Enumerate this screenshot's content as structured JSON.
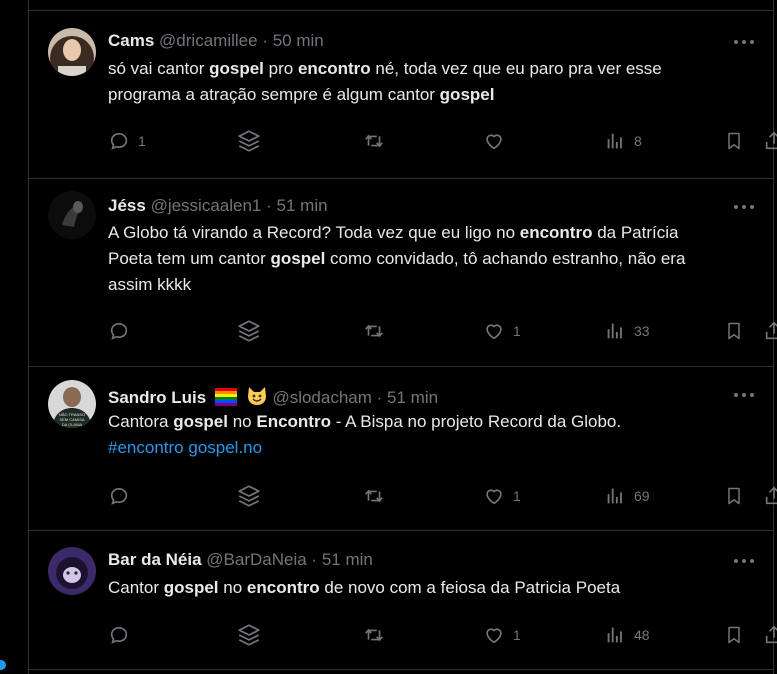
{
  "tweets": [
    {
      "name": "Cams",
      "handle": "@dricamillee",
      "sep": "·",
      "time": "50 min",
      "lines": [
        [
          {
            "t": "só vai cantor "
          },
          {
            "b": "gospel"
          },
          {
            "t": " pro "
          },
          {
            "b": "encontro"
          },
          {
            "t": " né, toda vez que eu paro pra ver esse"
          }
        ],
        [
          {
            "t": "programa a atração sempre é algum cantor "
          },
          {
            "b": "gospel"
          }
        ]
      ],
      "replies": "1",
      "likes": "",
      "views": "8"
    },
    {
      "name": "Jéss",
      "handle": "@jessicaalen1",
      "sep": "·",
      "time": "51 min",
      "lines": [
        [
          {
            "t": "A Globo tá virando a Record? Toda vez que eu ligo no "
          },
          {
            "b": "encontro"
          },
          {
            "t": " da Patrícia"
          }
        ],
        [
          {
            "t": "Poeta tem um cantor "
          },
          {
            "b": "gospel"
          },
          {
            "t": " como convidado, tô achando estranho, não era"
          }
        ],
        [
          {
            "t": "assim kkkk"
          }
        ]
      ],
      "replies": "",
      "likes": "1",
      "views": "33"
    },
    {
      "name": "Sandro Luis",
      "handle": "@slodacham",
      "sep": "·",
      "time": "51 min",
      "emojis": [
        "rainbow-flag",
        "smiling-cat"
      ],
      "avatar_text": [
        "NÃO TRANSO",
        "SEM CAMISA",
        "DA GLAMA"
      ],
      "lines": [
        [
          {
            "t": "Cantora "
          },
          {
            "b": "gospel"
          },
          {
            "t": " no "
          },
          {
            "b": "Encontro"
          },
          {
            "t": " - A Bispa no projeto Record da Globo."
          }
        ],
        [
          {
            "tag": "#encontro"
          },
          {
            "t": " "
          },
          {
            "link": "gospel.no"
          }
        ]
      ],
      "replies": "",
      "likes": "1",
      "views": "69"
    },
    {
      "name": "Bar da Néia",
      "handle": "@BarDaNeia",
      "sep": "·",
      "time": "51 min",
      "lines": [
        [
          {
            "t": "Cantor "
          },
          {
            "b": "gospel"
          },
          {
            "t": " no "
          },
          {
            "b": "encontro"
          },
          {
            "t": " de novo com a feiosa da Patricia Poeta"
          }
        ]
      ],
      "replies": "",
      "likes": "1",
      "views": "48"
    }
  ],
  "colors": {
    "background": "#000000",
    "text": "#e7e9ea",
    "muted": "#71767b",
    "accent": "#1d9bf0",
    "border": "#2f3336"
  },
  "icons": [
    "reply-icon",
    "grok-icon",
    "retweet-icon",
    "like-icon",
    "views-icon",
    "bookmark-icon",
    "share-icon",
    "more-icon"
  ]
}
